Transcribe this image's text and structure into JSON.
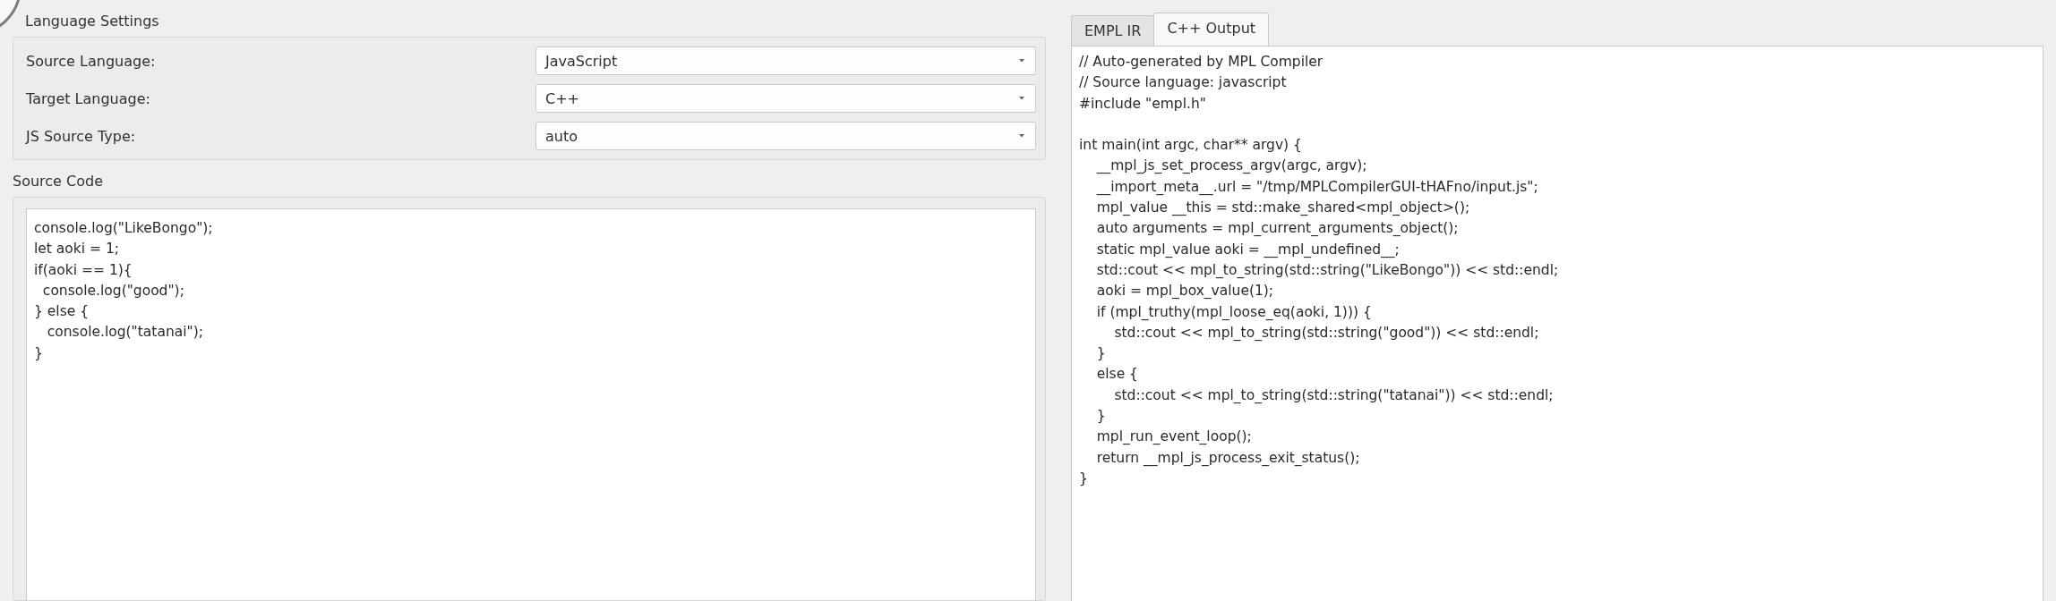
{
  "language_settings": {
    "title": "Language Settings",
    "rows": [
      {
        "label": "Source Language:",
        "value": "JavaScript"
      },
      {
        "label": "Target Language:",
        "value": "C++"
      },
      {
        "label": "JS Source Type:",
        "value": "auto"
      }
    ]
  },
  "source_code": {
    "title": "Source Code",
    "lines": [
      "console.log(\"LikeBongo\");",
      "let aoki = 1;",
      "if(aoki == 1){",
      "  console.log(\"good\");",
      "} else {",
      "   console.log(\"tatanai\");",
      "}"
    ]
  },
  "output": {
    "tabs": [
      {
        "label": "EMPL IR",
        "selected": false
      },
      {
        "label": "C++ Output",
        "selected": true
      }
    ],
    "header_lines": [
      "// Auto-generated by MPL Compiler",
      "// Source language: javascript",
      "#include \"empl.h\""
    ],
    "lines": [
      "int main(int argc, char** argv) {",
      "    __mpl_js_set_process_argv(argc, argv);",
      "    __import_meta__.url = \"/tmp/MPLCompilerGUI-tHAFno/input.js\";",
      "    mpl_value __this = std::make_shared<mpl_object>();",
      "    auto arguments = mpl_current_arguments_object();",
      "    static mpl_value aoki = __mpl_undefined__;",
      "    std::cout << mpl_to_string(std::string(\"LikeBongo\")) << std::endl;",
      "    aoki = mpl_box_value(1);",
      "    if (mpl_truthy(mpl_loose_eq(aoki, 1))) {",
      "        std::cout << mpl_to_string(std::string(\"good\")) << std::endl;",
      "    }",
      "    else {",
      "        std::cout << mpl_to_string(std::string(\"tatanai\")) << std::endl;",
      "    }",
      "    mpl_run_event_loop();",
      "    return __mpl_js_process_exit_status();",
      "}"
    ]
  }
}
